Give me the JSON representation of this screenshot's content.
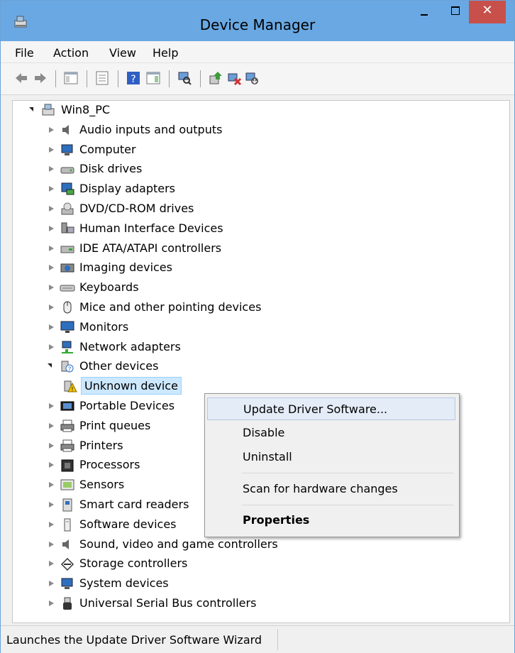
{
  "window": {
    "title": "Device Manager",
    "close_glyph": "✕"
  },
  "menu": [
    "File",
    "Action",
    "View",
    "Help"
  ],
  "tree": {
    "root": "Win8_PC",
    "categories": [
      {
        "label": "Audio inputs and outputs",
        "icon": "speaker-icon",
        "expanded": false
      },
      {
        "label": "Computer",
        "icon": "computer-icon",
        "expanded": false
      },
      {
        "label": "Disk drives",
        "icon": "disk-drive-icon",
        "expanded": false
      },
      {
        "label": "Display adapters",
        "icon": "display-adapter-icon",
        "expanded": false
      },
      {
        "label": "DVD/CD-ROM drives",
        "icon": "dvd-drive-icon",
        "expanded": false
      },
      {
        "label": "Human Interface Devices",
        "icon": "hid-icon",
        "expanded": false
      },
      {
        "label": "IDE ATA/ATAPI controllers",
        "icon": "ide-controller-icon",
        "expanded": false
      },
      {
        "label": "Imaging devices",
        "icon": "camera-icon",
        "expanded": false
      },
      {
        "label": "Keyboards",
        "icon": "keyboard-icon",
        "expanded": false
      },
      {
        "label": "Mice and other pointing devices",
        "icon": "mouse-icon",
        "expanded": false
      },
      {
        "label": "Monitors",
        "icon": "monitor-icon",
        "expanded": false
      },
      {
        "label": "Network adapters",
        "icon": "network-icon",
        "expanded": false
      },
      {
        "label": "Other devices",
        "icon": "question-device-icon",
        "expanded": true
      },
      {
        "label": "Unknown device",
        "icon": "warning-device-icon",
        "child": true,
        "selected": true
      },
      {
        "label": "Portable Devices",
        "icon": "portable-device-icon",
        "expanded": false
      },
      {
        "label": "Print queues",
        "icon": "printer-icon",
        "expanded": false
      },
      {
        "label": "Printers",
        "icon": "printer-icon",
        "expanded": false
      },
      {
        "label": "Processors",
        "icon": "processor-icon",
        "expanded": false
      },
      {
        "label": "Sensors",
        "icon": "sensor-icon",
        "expanded": false
      },
      {
        "label": "Smart card readers",
        "icon": "smart-card-icon",
        "expanded": false
      },
      {
        "label": "Software devices",
        "icon": "software-device-icon",
        "expanded": false
      },
      {
        "label": "Sound, video and game controllers",
        "icon": "speaker-icon",
        "expanded": false
      },
      {
        "label": "Storage controllers",
        "icon": "storage-icon",
        "expanded": false
      },
      {
        "label": "System devices",
        "icon": "computer-icon",
        "expanded": false
      },
      {
        "label": "Universal Serial Bus controllers",
        "icon": "usb-icon",
        "expanded": false
      }
    ]
  },
  "context_menu": {
    "update": "Update Driver Software...",
    "disable": "Disable",
    "uninstall": "Uninstall",
    "scan": "Scan for hardware changes",
    "properties": "Properties"
  },
  "status": {
    "text": "Launches the Update Driver Software Wizard"
  },
  "colors": {
    "titlebar": "#69a8e3",
    "close": "#c7504b",
    "selection": "#cce8ff",
    "menu_hover": "#e4ecf7"
  }
}
